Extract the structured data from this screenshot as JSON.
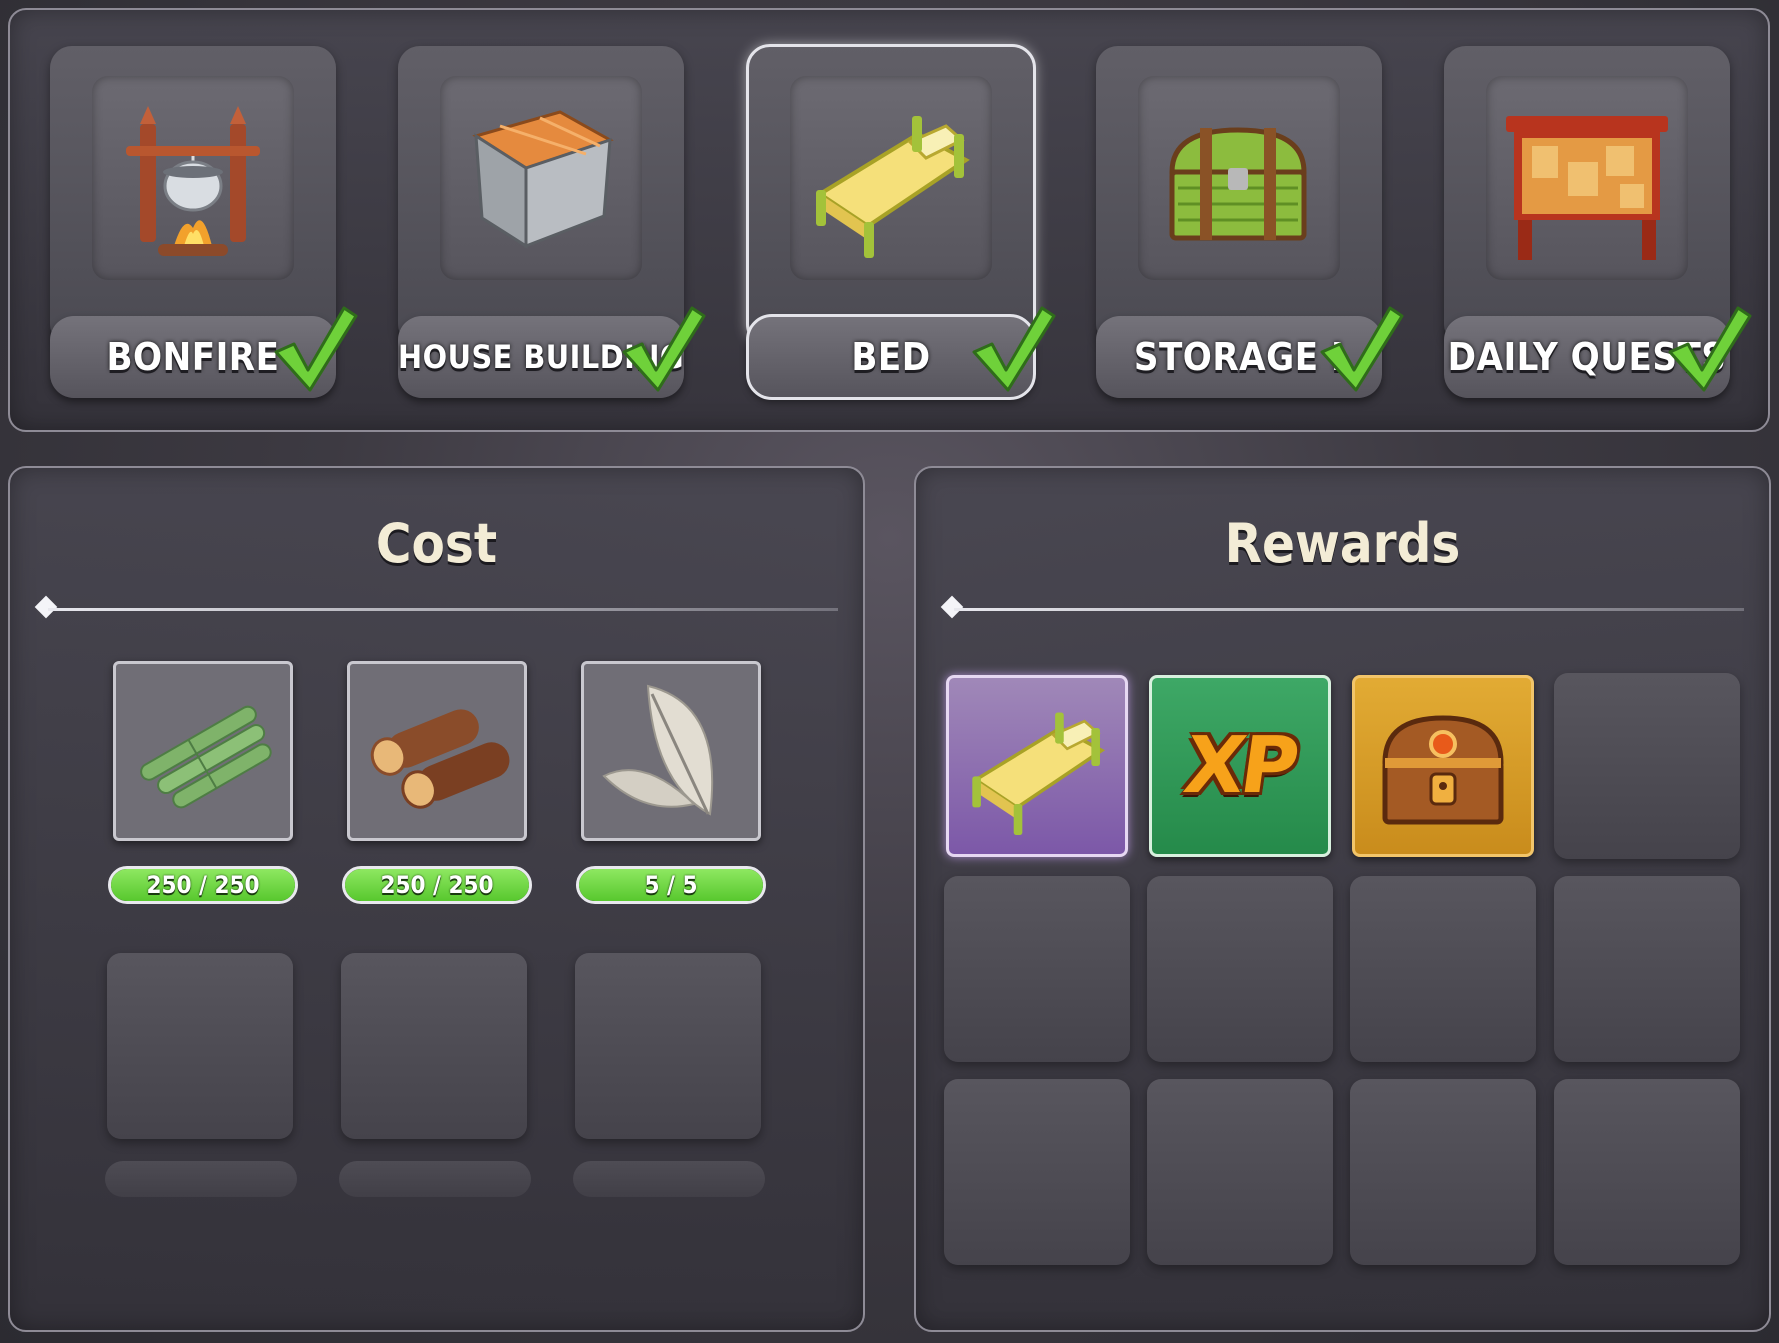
{
  "buildings": [
    {
      "label": "BONFIRE",
      "icon": "bonfire-icon",
      "completed": true,
      "selected": false
    },
    {
      "label": "HOUSE BUILDING I",
      "icon": "house-building-icon",
      "completed": true,
      "selected": false
    },
    {
      "label": "BED",
      "icon": "bed-icon",
      "completed": true,
      "selected": true
    },
    {
      "label": "STORAGE I",
      "icon": "storage-chest-icon",
      "completed": true,
      "selected": false
    },
    {
      "label": "DAILY QUESTS",
      "icon": "quest-board-icon",
      "completed": true,
      "selected": false
    }
  ],
  "cost": {
    "title": "Cost",
    "items": [
      {
        "icon": "bamboo-icon",
        "progress": "250 / 250",
        "fraction": 1.0
      },
      {
        "icon": "wood-logs-icon",
        "progress": "250 / 250",
        "fraction": 1.0
      },
      {
        "icon": "feather-icon",
        "progress": "5 / 5",
        "fraction": 1.0
      }
    ]
  },
  "rewards": {
    "title": "Rewards",
    "items": [
      {
        "icon": "bed-icon",
        "rarity_color": "#8b63b0"
      },
      {
        "icon": "xp-icon",
        "text": "XP",
        "rarity_color": "#2f9a58"
      },
      {
        "icon": "treasure-chest-icon",
        "rarity_color": "#d69c26"
      }
    ]
  },
  "colors": {
    "check": "#6fd13a",
    "progress_fill": "#6dd844",
    "title_text": "#f3ecd6"
  }
}
